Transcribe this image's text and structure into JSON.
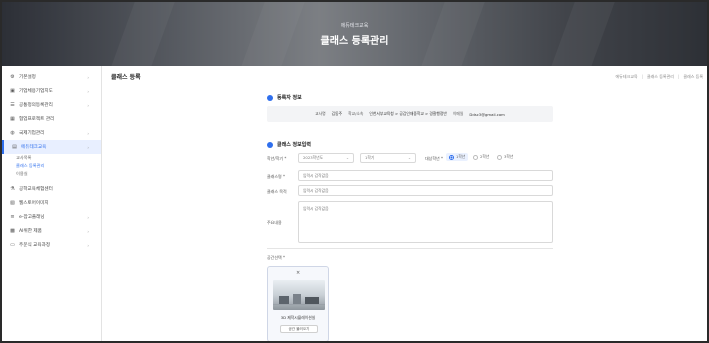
{
  "hero": {
    "subtitle": "에듀테크교육",
    "title": "클래스 등록관리"
  },
  "sidebar": {
    "items": [
      {
        "label": "기본설정",
        "icon": "gear-icon",
        "chevron": "›"
      },
      {
        "label": "기업체용기업지도",
        "icon": "building-icon",
        "chevron": "›"
      },
      {
        "label": "공통정의등록관리",
        "icon": "list-icon",
        "chevron": "›"
      },
      {
        "label": "협업프로젝트 관리",
        "icon": "grid-icon",
        "chevron": ""
      },
      {
        "label": "국제기업관리",
        "icon": "globe-icon",
        "chevron": "›"
      },
      {
        "label": "에듀테크교육",
        "icon": "book-icon",
        "chevron": "›",
        "active": true
      }
    ],
    "subitems": [
      {
        "label": "교사목록",
        "active": false
      },
      {
        "label": "클래스 등록관리",
        "active": true
      },
      {
        "label": "이용실",
        "active": false
      }
    ],
    "items2": [
      {
        "label": "공학교육체험센터",
        "icon": "flask-icon",
        "chevron": ""
      },
      {
        "label": "웹스토어이미지",
        "icon": "image-icon",
        "chevron": ""
      },
      {
        "label": "e-잡고플래닝",
        "icon": "menu-icon",
        "chevron": "›"
      },
      {
        "label": "AI위한 제품",
        "icon": "chip-icon",
        "chevron": "›"
      },
      {
        "label": "주문식 교육과정",
        "icon": "document-icon",
        "chevron": "›"
      }
    ]
  },
  "main": {
    "page_title": "클래스 등록",
    "breadcrumbs": [
      "에듀테크교육",
      "클래스 등록관리",
      "클래스 등록"
    ],
    "registrant": {
      "section_title": "등록자 정보",
      "teacher_label": "교사명",
      "teacher_value": "김동주",
      "school_label": "학교/소속",
      "school_value": "인천서부교육청 > 공감인재중학교 > 경찰행정반",
      "email_label": "이메일",
      "email_value": "Ddsc3@gmail.com"
    },
    "class_info": {
      "section_title": "클래스 정보입력",
      "year_label": "학년/학기 *",
      "year_value": "2023학년도",
      "term_value": "1학기",
      "grade_label": "대상학년 *",
      "grade_options": [
        "1학년",
        "2학년",
        "3학년"
      ],
      "grade_selected": "1학년",
      "class_name_label": "클래스명 *",
      "class_name_placeholder": "입력시 감작값음",
      "class_goal_label": "클래스 목적",
      "class_goal_placeholder": "입력시 감작값음",
      "description_label": "주요내용",
      "description_placeholder": "입력시 감작값음"
    },
    "space": {
      "label": "공간선택 *",
      "card_name": "3D 제작시뮬레이션실",
      "card_button": "공간 불러오기",
      "close_icon": "×"
    }
  }
}
